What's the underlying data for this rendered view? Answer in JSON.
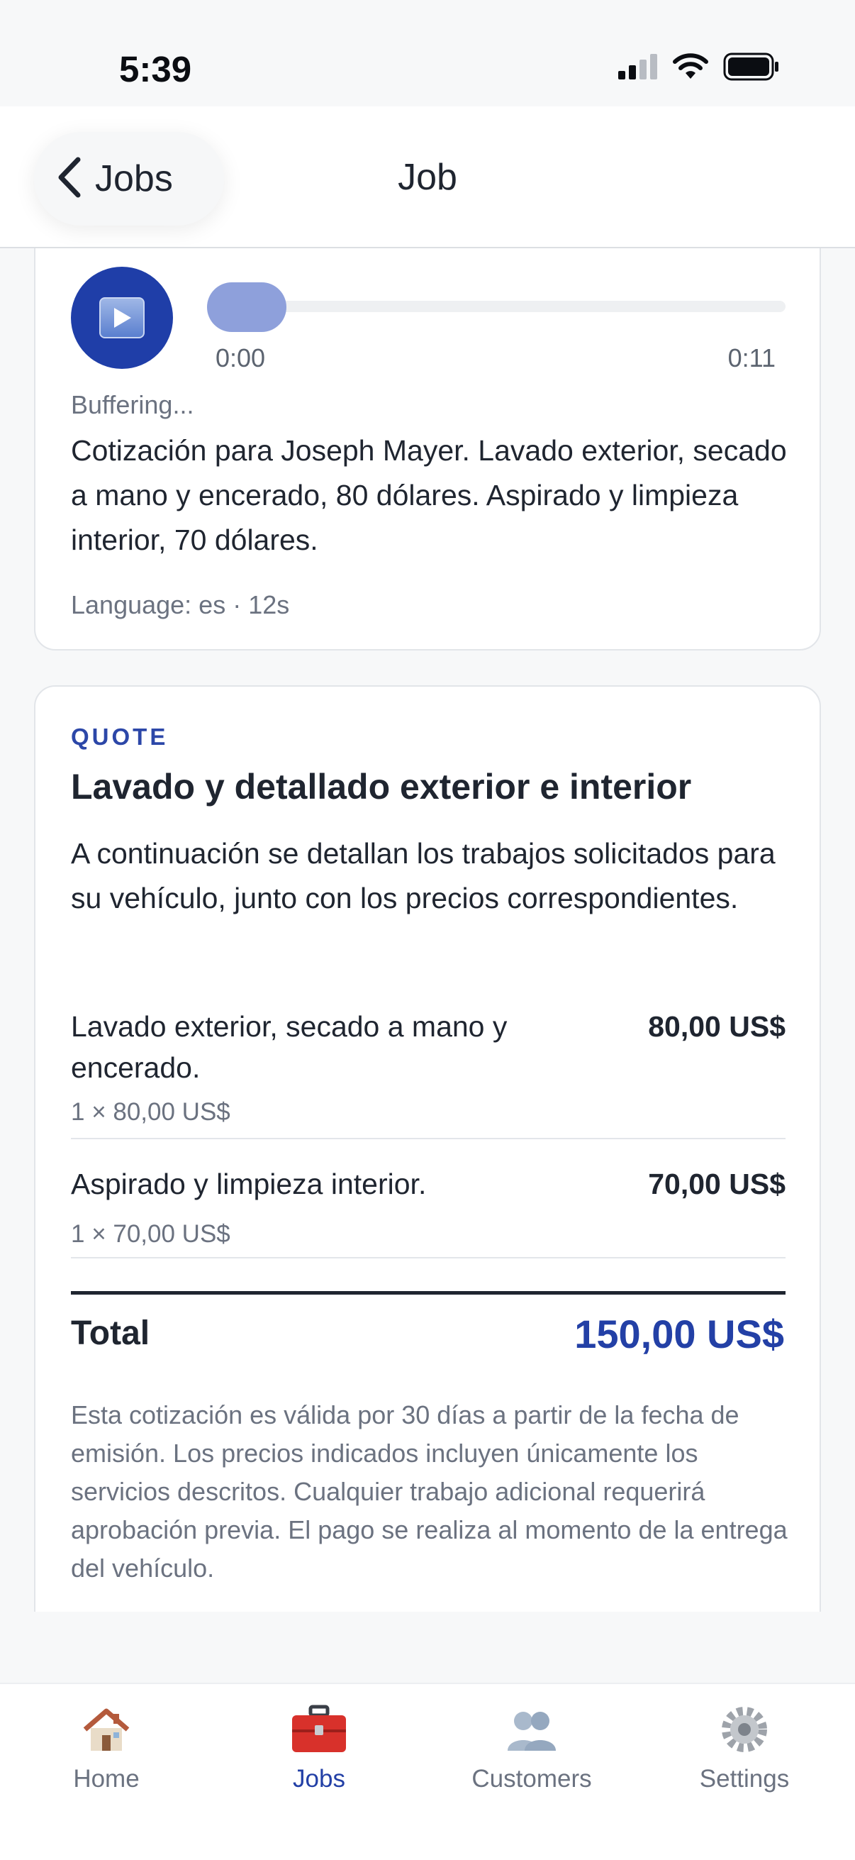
{
  "status_bar": {
    "time": "5:39"
  },
  "nav": {
    "back_label": "Jobs",
    "title": "Job"
  },
  "audio": {
    "time_start": "0:00",
    "time_end": "0:11",
    "progress": 0,
    "status": "Buffering...",
    "transcript": "Cotización para Joseph Mayer. Lavado exterior, secado a mano y encerado, 80 dólares. Aspirado y limpieza interior, 70 dólares.",
    "meta": "Language: es · 12s"
  },
  "quote": {
    "kicker": "QUOTE",
    "title": "Lavado y detallado exterior e interior",
    "description": "A continuación se detallan los trabajos solicitados para su vehículo, junto con los precios correspondientes.",
    "line_items": [
      {
        "name": "Lavado exterior, secado a mano y encerado.",
        "price": "80,00 US$",
        "qty": "1 × 80,00 US$"
      },
      {
        "name": "Aspirado y limpieza interior.",
        "price": "70,00 US$",
        "qty": "1 × 70,00 US$"
      }
    ],
    "total_label": "Total",
    "total_value": "150,00 US$",
    "terms": "Esta cotización es válida por 30 días a partir de la fecha de emisión. Los precios indicados incluyen únicamente los servicios descritos. Cualquier trabajo adicional requerirá aprobación previa. El pago se realiza al momento de la entrega del vehículo."
  },
  "tabs": [
    {
      "label": "Home",
      "icon": "house-icon",
      "active": false
    },
    {
      "label": "Jobs",
      "icon": "toolbox-icon",
      "active": true
    },
    {
      "label": "Customers",
      "icon": "people-icon",
      "active": false
    },
    {
      "label": "Settings",
      "icon": "gear-icon",
      "active": false
    }
  ],
  "colors": {
    "accent": "#2340a6",
    "play_button": "#1f3ea8",
    "text": "#1f2530",
    "muted": "#6b7280"
  }
}
